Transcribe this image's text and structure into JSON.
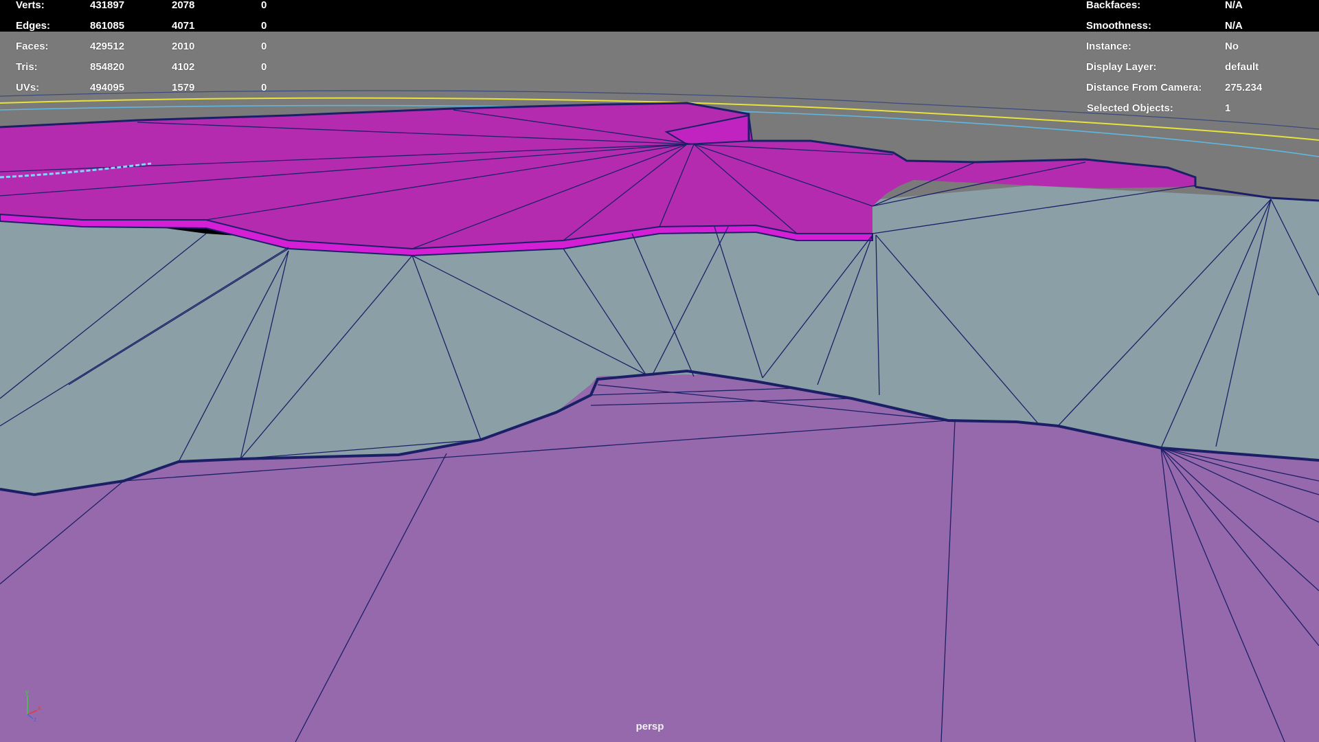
{
  "viewport": {
    "camera": "persp",
    "colors": {
      "background_top": "#000000",
      "background": "#7a7a7a",
      "mesh_selected": "#b52bb0",
      "mesh_sea": "#8a9fa6",
      "mesh_terrain": "#9669ac",
      "wireframe": "#1b1f66",
      "curve_yellow": "#e8e23a",
      "curve_blue": "#5fb8e0",
      "hud_text": "#ffffff"
    }
  },
  "hud_left": {
    "rows": [
      {
        "label": "Verts:",
        "total": "431897",
        "selected": "2078",
        "tri": "0"
      },
      {
        "label": "Edges:",
        "total": "861085",
        "selected": "4071",
        "tri": "0"
      },
      {
        "label": "Faces:",
        "total": "429512",
        "selected": "2010",
        "tri": "0"
      },
      {
        "label": "Tris:",
        "total": "854820",
        "selected": "4102",
        "tri": "0"
      },
      {
        "label": "UVs:",
        "total": "494095",
        "selected": "1579",
        "tri": "0"
      }
    ]
  },
  "hud_right": {
    "rows": [
      {
        "label": "Backfaces:",
        "value": "N/A"
      },
      {
        "label": "Smoothness:",
        "value": "N/A"
      },
      {
        "label": "Instance:",
        "value": "No"
      },
      {
        "label": "Display Layer:",
        "value": "default"
      },
      {
        "label": "Distance From Camera:",
        "value": "275.234"
      },
      {
        "label": "Selected Objects:",
        "value": "1"
      }
    ]
  },
  "axis_gizmo": {
    "x": "x",
    "y": "y",
    "z": "z"
  }
}
